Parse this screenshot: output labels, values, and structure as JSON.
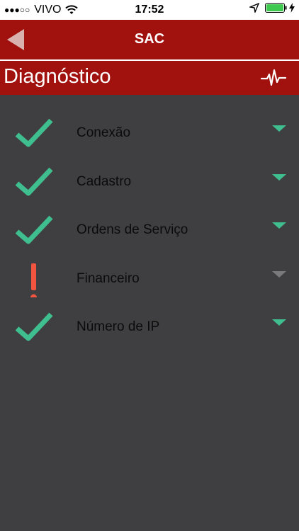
{
  "status_bar": {
    "signal": "●●●○○",
    "carrier": "VIVO",
    "time": "17:52"
  },
  "header": {
    "title": "SAC"
  },
  "section": {
    "title": "Diagnóstico",
    "icon": "pulse-icon"
  },
  "colors": {
    "header_bg": "#a1110d",
    "body_bg": "#3f3f41",
    "ok": "#3fbf8f",
    "warning": "#f2543f",
    "muted": "#7a7a7c"
  },
  "items": [
    {
      "label": "Conexão",
      "status": "ok"
    },
    {
      "label": "Cadastro",
      "status": "ok"
    },
    {
      "label": "Ordens de Serviço",
      "status": "ok"
    },
    {
      "label": "Financeiro",
      "status": "warning"
    },
    {
      "label": "Número de IP",
      "status": "ok"
    }
  ]
}
